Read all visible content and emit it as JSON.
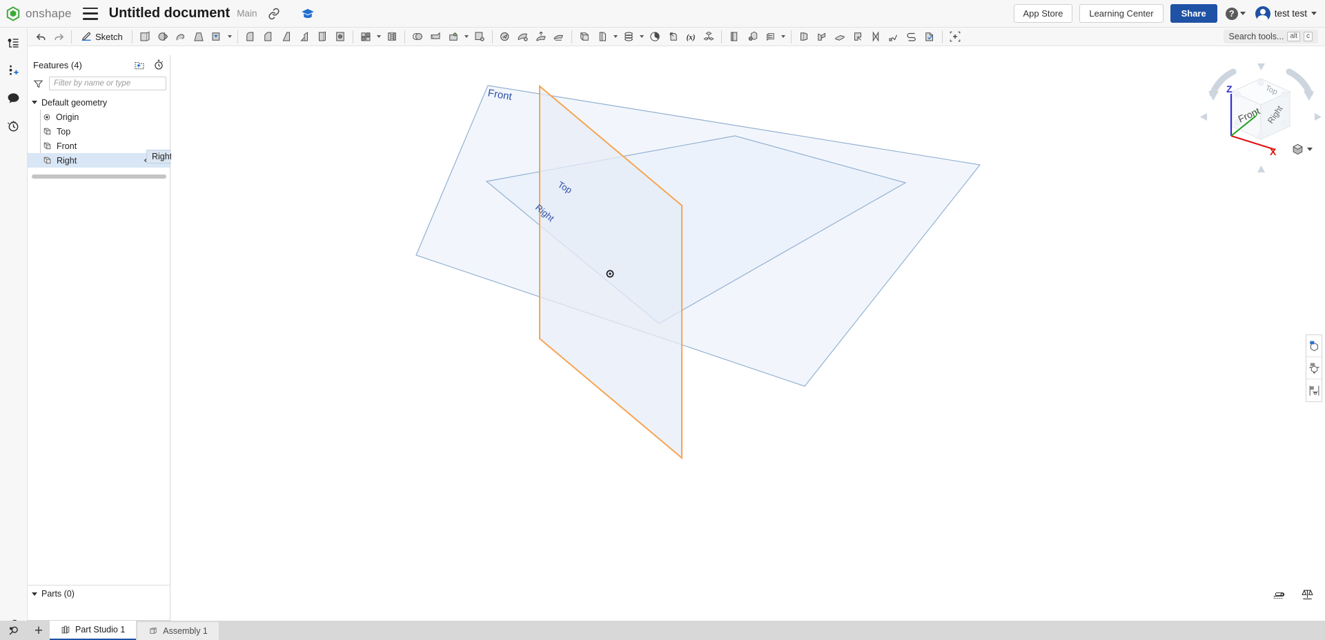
{
  "app": {
    "brand": "onshape",
    "brand_color": "#3aaa35"
  },
  "header": {
    "menu_icon": "hamburger-icon",
    "doc_title": "Untitled document",
    "branch": "Main",
    "link_icon": "link-icon",
    "learning_icon": "graduation-cap-icon",
    "app_store_label": "App Store",
    "learning_center_label": "Learning Center",
    "share_label": "Share",
    "help_label": "?",
    "user_name": "test test",
    "share_color": "#1f52a5"
  },
  "toolbar": {
    "undo_label": "Undo",
    "redo_label": "Redo",
    "sketch_label": "Sketch",
    "search_placeholder": "Search tools...",
    "search_key1": "alt",
    "search_key2": "c",
    "tools": [
      "extrude-icon",
      "revolve-icon",
      "sweep-icon",
      "loft-icon",
      "thicken-icon",
      "fillet-icon",
      "chamfer-icon",
      "draft-icon",
      "rib-icon",
      "shell-icon",
      "hole-icon",
      "linear-pattern-icon",
      "mirror-icon",
      "boolean-icon",
      "split-icon",
      "transform-icon",
      "delete-face-icon",
      "move-face-icon",
      "replace-face-icon",
      "offset-surface-icon",
      "enclose-icon",
      "plane-icon",
      "sketch-plane-icon",
      "curve-icon",
      "helix-icon",
      "variable-icon",
      "assembly-icon",
      "derived-icon",
      "configuration-icon",
      "composite-part-icon",
      "sheet-metal-icon",
      "bend-icon",
      "flange-icon",
      "tab-icon",
      "unfold-icon",
      "jog-icon",
      "corner-icon",
      "sheetmetal-model-icon",
      "insert-icon"
    ]
  },
  "left_rail": [
    {
      "name": "feature-list-icon",
      "label": "Feature list"
    },
    {
      "name": "add-version-icon",
      "label": "Add version"
    },
    {
      "name": "comments-icon",
      "label": "Comments"
    },
    {
      "name": "history-icon",
      "label": "History"
    }
  ],
  "left_rail_bottom": {
    "name": "search-document-icon",
    "label": "Search in document"
  },
  "feature_tree": {
    "title": "Features (4)",
    "folder_icon": "new-folder-icon",
    "rollback_icon": "rollback-timer-icon",
    "filter_icon": "filter-funnel-icon",
    "filter_placeholder": "Filter by name or type",
    "filter_value": "",
    "group_label": "Default geometry",
    "items": [
      {
        "label": "Origin",
        "icon": "origin-icon",
        "selected": false,
        "visible": false
      },
      {
        "label": "Top",
        "icon": "plane-icon",
        "selected": false,
        "visible": false
      },
      {
        "label": "Front",
        "icon": "plane-icon",
        "selected": false,
        "visible": false
      },
      {
        "label": "Right",
        "icon": "plane-icon",
        "selected": true,
        "visible": true
      }
    ],
    "tooltip": "Right",
    "parts_label": "Parts (0)",
    "selected_color": "#d8e6f6"
  },
  "viewport": {
    "planes": [
      {
        "label": "Front",
        "selected": false,
        "color": "#7f9fc4"
      },
      {
        "label": "Top",
        "selected": false,
        "color": "#7f9fc4"
      },
      {
        "label": "Right",
        "selected": true,
        "color": "#f5a551"
      }
    ],
    "origin_marker": "origin-point",
    "selected_plane_color": "#f5a551",
    "plane_fill": "#eef3fa",
    "view_cube": {
      "faces": [
        "Top",
        "Front",
        "Right"
      ],
      "axes": [
        {
          "name": "Z",
          "color": "#3030d0"
        },
        {
          "name": "Y",
          "color": "#19a019"
        },
        {
          "name": "X",
          "color": "#e01010"
        }
      ],
      "view_menu_icon": "view-cube-menu-icon"
    },
    "right_panels": [
      {
        "name": "display-state-icon",
        "label": "Display states"
      },
      {
        "name": "render-studio-icon",
        "label": "Render"
      },
      {
        "name": "appearance-icon",
        "label": "Appearances"
      }
    ],
    "bottom_right": [
      {
        "name": "measure-icon",
        "label": "Measure"
      },
      {
        "name": "mass-properties-icon",
        "label": "Mass properties"
      }
    ],
    "float_list_icon": "feature-list-toggle-icon"
  },
  "tabs": {
    "search_icon": "tab-search-icon",
    "add_label": "+",
    "items": [
      {
        "label": "Part Studio 1",
        "icon": "part-studio-icon",
        "active": true
      },
      {
        "label": "Assembly 1",
        "icon": "assembly-icon",
        "active": false
      }
    ]
  }
}
